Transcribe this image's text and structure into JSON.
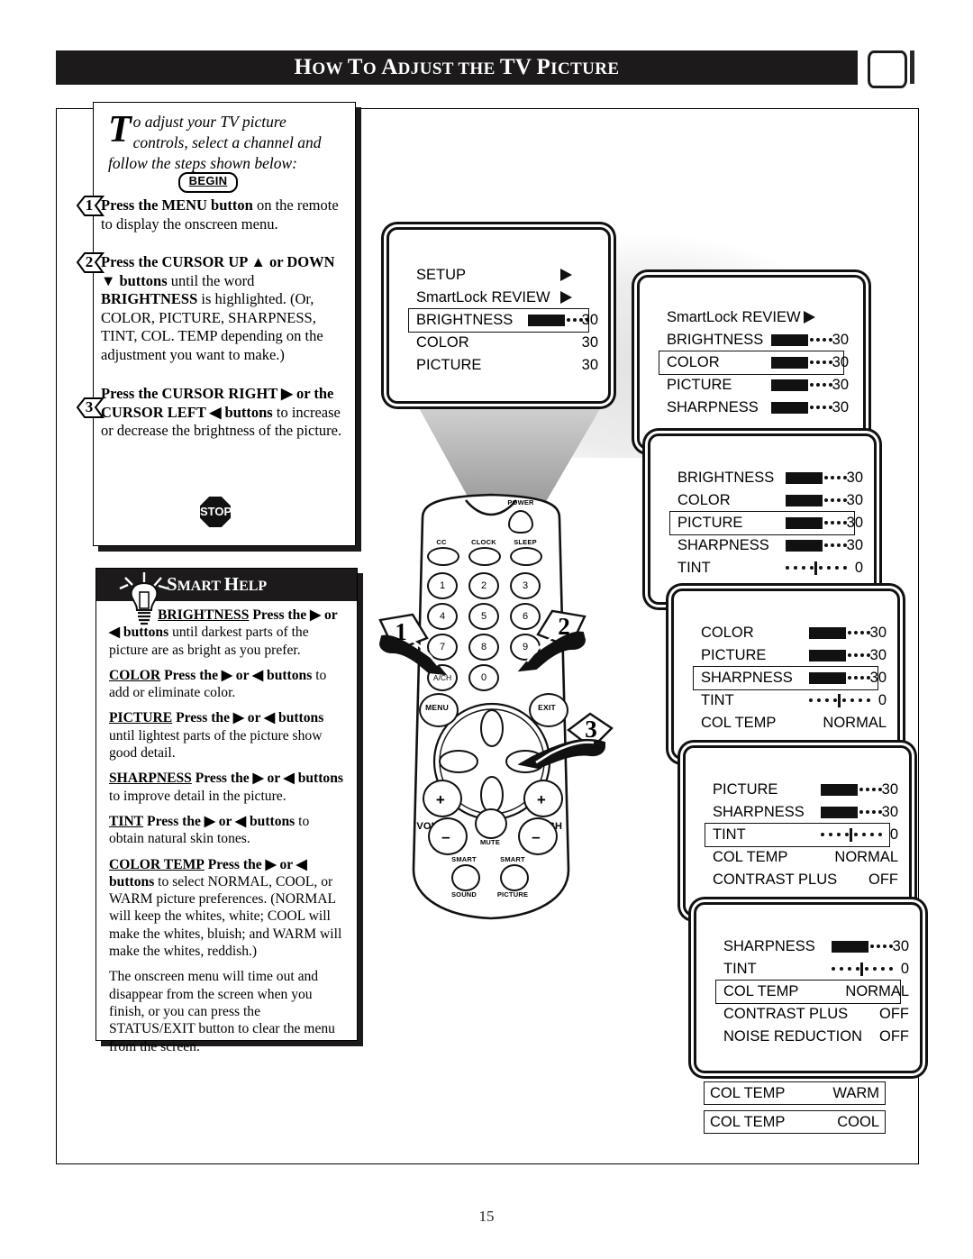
{
  "header": {
    "title_parts": [
      {
        "t": "H",
        "big": true
      },
      {
        "t": "OW",
        "big": false
      },
      {
        "t": " ",
        "big": false
      },
      {
        "t": "T",
        "big": true
      },
      {
        "t": "O",
        "big": false
      },
      {
        "t": " ",
        "big": false
      },
      {
        "t": "A",
        "big": true
      },
      {
        "t": "DJUST",
        "big": false
      },
      {
        "t": " ",
        "big": false
      },
      {
        "t": "THE",
        "big": false
      },
      {
        "t": " ",
        "big": false
      },
      {
        "t": "TV",
        "big": true
      },
      {
        "t": " ",
        "big": false
      },
      {
        "t": "P",
        "big": true
      },
      {
        "t": "ICTURE",
        "big": false
      }
    ],
    "title_plain": "How to Adjust the TV Picture",
    "tv_icon": "tv-screen-icon"
  },
  "intro": {
    "dropcap": "T",
    "text": "o adjust your TV picture controls, select a channel and follow the steps shown below:"
  },
  "begin_badge": "BEGIN",
  "steps": [
    {
      "num": "1",
      "html": "<b>Press the MENU button</b> on the remote to display the onscreen menu."
    },
    {
      "num": "2",
      "html": "<b>Press the CURSOR UP ▲ or DOWN ▼ buttons</b> until the word <b>BRIGHTNESS</b> is highlighted. (Or, COLOR, PICTURE, SHARPNESS, TINT, COL. TEMP depending on the adjustment you want to make.)"
    },
    {
      "num": "3",
      "html": "<b>Press the CURSOR RIGHT ▶ or the CURSOR LEFT ◀ buttons</b> to increase or decrease the brightness of the picture."
    }
  ],
  "stop_label": "STOP",
  "smart_help": {
    "title_parts": [
      {
        "t": "S",
        "big": true
      },
      {
        "t": "MART",
        "big": false
      },
      {
        "t": " ",
        "big": false
      },
      {
        "t": "H",
        "big": true
      },
      {
        "t": "ELP",
        "big": false
      }
    ],
    "title_plain": "Smart Help",
    "paragraphs": [
      "<span class=\"u\">BRIGHTNESS</span> <span class=\"bd\">Press the ▶ or ◀ buttons</span> until darkest parts of the picture are as bright as you prefer.",
      "<span class=\"u\">COLOR</span> <span class=\"bd\">Press the ▶ or ◀ buttons</span> to add or eliminate color.",
      "<span class=\"u\">PICTURE</span> <span class=\"bd\">Press the ▶ or ◀ buttons</span> until lightest parts of the picture show good detail.",
      "<span class=\"u\">SHARPNESS</span> <span class=\"bd\">Press the ▶ or ◀ buttons</span> to improve detail in the picture.",
      "<span class=\"u\">TINT</span> <span class=\"bd\">Press the ▶ or ◀ buttons</span> to obtain natural skin tones.",
      "<span class=\"u\">COLOR TEMP</span> <span class=\"bd\">Press the ▶ or ◀ buttons</span> to select NORMAL, COOL, or WARM picture preferences. (NORMAL will keep the whites, white; COOL will make the whites, bluish; and WARM will make the whites, reddish.)",
      "The onscreen menu will time out and disappear from the screen when you finish, or you can press the STATUS/EXIT button to clear the menu from the screen."
    ]
  },
  "menus": [
    {
      "name": "menu-screen-1",
      "rows": [
        {
          "label": "SETUP",
          "type": "arrow"
        },
        {
          "label": "SmartLock REVIEW",
          "type": "arrow"
        },
        {
          "label": "BRIGHTNESS",
          "type": "bar",
          "value": "30",
          "fill": 60,
          "highlighted": true
        },
        {
          "label": "COLOR",
          "type": "value",
          "value": "30"
        },
        {
          "label": "PICTURE",
          "type": "value",
          "value": "30"
        }
      ]
    },
    {
      "name": "menu-screen-2",
      "rows": [
        {
          "label": "SmartLock REVIEW",
          "type": "arrow"
        },
        {
          "label": "BRIGHTNESS",
          "type": "bar",
          "value": "30",
          "fill": 60
        },
        {
          "label": "COLOR",
          "type": "bar",
          "value": "30",
          "fill": 60,
          "highlighted": true
        },
        {
          "label": "PICTURE",
          "type": "bar",
          "value": "30",
          "fill": 60
        },
        {
          "label": "SHARPNESS",
          "type": "bar",
          "value": "30",
          "fill": 60
        }
      ]
    },
    {
      "name": "menu-screen-3",
      "rows": [
        {
          "label": "BRIGHTNESS",
          "type": "bar",
          "value": "30",
          "fill": 60
        },
        {
          "label": "COLOR",
          "type": "bar",
          "value": "30",
          "fill": 60
        },
        {
          "label": "PICTURE",
          "type": "bar",
          "value": "30",
          "fill": 60,
          "highlighted": true
        },
        {
          "label": "SHARPNESS",
          "type": "bar",
          "value": "30",
          "fill": 60
        },
        {
          "label": "TINT",
          "type": "tint",
          "value": "0"
        }
      ]
    },
    {
      "name": "menu-screen-4",
      "rows": [
        {
          "label": "COLOR",
          "type": "bar",
          "value": "30",
          "fill": 60
        },
        {
          "label": "PICTURE",
          "type": "bar",
          "value": "30",
          "fill": 60
        },
        {
          "label": "SHARPNESS",
          "type": "bar",
          "value": "30",
          "fill": 60,
          "highlighted": true
        },
        {
          "label": "TINT",
          "type": "tint",
          "value": "0"
        },
        {
          "label": "COL TEMP",
          "type": "value",
          "value": "NORMAL"
        }
      ]
    },
    {
      "name": "menu-screen-5",
      "rows": [
        {
          "label": "PICTURE",
          "type": "bar",
          "value": "30",
          "fill": 60
        },
        {
          "label": "SHARPNESS",
          "type": "bar",
          "value": "30",
          "fill": 60
        },
        {
          "label": "TINT",
          "type": "tint",
          "value": "0",
          "highlighted": true
        },
        {
          "label": "COL TEMP",
          "type": "value",
          "value": "NORMAL"
        },
        {
          "label": "CONTRAST PLUS",
          "type": "value",
          "value": "OFF"
        }
      ]
    },
    {
      "name": "menu-screen-6",
      "rows": [
        {
          "label": "SHARPNESS",
          "type": "bar",
          "value": "30",
          "fill": 60
        },
        {
          "label": "TINT",
          "type": "tint",
          "value": "0"
        },
        {
          "label": "COL TEMP",
          "type": "value",
          "value": "NORMAL",
          "highlighted": true
        },
        {
          "label": "CONTRAST PLUS",
          "type": "value",
          "value": "OFF"
        },
        {
          "label": "NOISE REDUCTION",
          "type": "value",
          "value": "OFF"
        }
      ]
    }
  ],
  "coltemp_boxes": [
    {
      "label": "COL TEMP",
      "value": "WARM"
    },
    {
      "label": "COL TEMP",
      "value": "COOL"
    }
  ],
  "remote": {
    "power_label": "POWER",
    "top_keys": [
      "CC",
      "CLOCK",
      "SLEEP"
    ],
    "numpad": [
      "1",
      "2",
      "3",
      "4",
      "5",
      "6",
      "7",
      "8",
      "9",
      "A/CH",
      "0"
    ],
    "menu_label": "MENU",
    "exit_label": "EXIT",
    "vol_label": "VOL",
    "ch_label": "CH",
    "mute_label": "MUTE",
    "smart_sound": [
      "SMART",
      "SOUND"
    ],
    "smart_picture": [
      "SMART",
      "PICTURE"
    ],
    "plus": "+",
    "minus": "–"
  },
  "pointers": [
    {
      "num": "1",
      "name": "pointer-hand-1"
    },
    {
      "num": "2",
      "name": "pointer-hand-2"
    },
    {
      "num": "3",
      "name": "pointer-hand-3"
    }
  ],
  "page_number": "15"
}
